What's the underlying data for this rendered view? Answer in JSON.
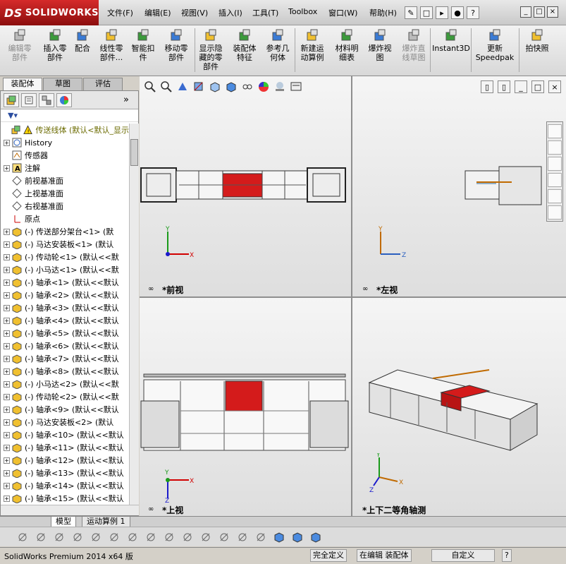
{
  "app": {
    "brand": "SOLIDWORKS",
    "brand_prefix": "DS"
  },
  "menu": [
    "文件(F)",
    "编辑(E)",
    "视图(V)",
    "插入(I)",
    "工具(T)",
    "Toolbox",
    "窗口(W)",
    "帮助(H)"
  ],
  "commands": [
    {
      "label": "编辑零\n部件",
      "disabled": true
    },
    {
      "label": "插入零\n部件",
      "disabled": false
    },
    {
      "label": "配合",
      "disabled": false
    },
    {
      "label": "线性零\n部件...",
      "disabled": false
    },
    {
      "label": "智能扣\n件",
      "disabled": false
    },
    {
      "label": "移动零\n部件",
      "disabled": false
    },
    {
      "label": "显示隐\n藏的零\n部件",
      "disabled": false
    },
    {
      "label": "装配体\n特征",
      "disabled": false
    },
    {
      "label": "参考几\n何体",
      "disabled": false
    },
    {
      "label": "新建运\n动算例",
      "disabled": false
    },
    {
      "label": "材料明\n细表",
      "disabled": false
    },
    {
      "label": "爆炸视\n图",
      "disabled": false
    },
    {
      "label": "爆炸直\n线草图",
      "disabled": true
    },
    {
      "label": "Instant3D",
      "disabled": false
    },
    {
      "label": "更新\nSpeedpak",
      "disabled": false
    },
    {
      "label": "拍快照",
      "disabled": false
    }
  ],
  "left_tabs": [
    "装配体",
    "草图",
    "评估"
  ],
  "tree": {
    "root": "传送线体  (默认<默认_显示",
    "items": [
      {
        "label": "History",
        "icon": "history-icon",
        "expand": true
      },
      {
        "label": "传感器",
        "icon": "sensor-icon",
        "expand": false
      },
      {
        "label": "注解",
        "icon": "annotation-icon",
        "expand": true
      },
      {
        "label": "前视基准面",
        "icon": "plane-icon",
        "expand": false
      },
      {
        "label": "上视基准面",
        "icon": "plane-icon",
        "expand": false
      },
      {
        "label": "右视基准面",
        "icon": "plane-icon",
        "expand": false
      },
      {
        "label": "原点",
        "icon": "origin-icon",
        "expand": false
      },
      {
        "label": "(-) 传送部分架台<1> (默",
        "icon": "part-icon",
        "expand": true
      },
      {
        "label": "(-) 马达安装板<1> (默认",
        "icon": "part-icon",
        "expand": true
      },
      {
        "label": "(-) 传动轮<1> (默认<<默",
        "icon": "part-icon",
        "expand": true
      },
      {
        "label": "(-) 小马达<1> (默认<<默",
        "icon": "part-icon",
        "expand": true
      },
      {
        "label": "(-) 轴承<1> (默认<<默认",
        "icon": "part-icon",
        "expand": true
      },
      {
        "label": "(-) 轴承<2> (默认<<默认",
        "icon": "part-icon",
        "expand": true
      },
      {
        "label": "(-) 轴承<3> (默认<<默认",
        "icon": "part-icon",
        "expand": true
      },
      {
        "label": "(-) 轴承<4> (默认<<默认",
        "icon": "part-icon",
        "expand": true
      },
      {
        "label": "(-) 轴承<5> (默认<<默认",
        "icon": "part-icon",
        "expand": true
      },
      {
        "label": "(-) 轴承<6> (默认<<默认",
        "icon": "part-icon",
        "expand": true
      },
      {
        "label": "(-) 轴承<7> (默认<<默认",
        "icon": "part-icon",
        "expand": true
      },
      {
        "label": "(-) 轴承<8> (默认<<默认",
        "icon": "part-icon",
        "expand": true
      },
      {
        "label": "(-) 小马达<2> (默认<<默",
        "icon": "part-icon",
        "expand": true
      },
      {
        "label": "(-) 传动轮<2> (默认<<默",
        "icon": "part-icon",
        "expand": true
      },
      {
        "label": "(-) 轴承<9> (默认<<默认",
        "icon": "part-icon",
        "expand": true
      },
      {
        "label": "(-) 马达安装板<2> (默认",
        "icon": "part-icon",
        "expand": true
      },
      {
        "label": "(-) 轴承<10> (默认<<默认",
        "icon": "part-icon",
        "expand": true
      },
      {
        "label": "(-) 轴承<11> (默认<<默认",
        "icon": "part-icon",
        "expand": true
      },
      {
        "label": "(-) 轴承<12> (默认<<默认",
        "icon": "part-icon",
        "expand": true
      },
      {
        "label": "(-) 轴承<13> (默认<<默认",
        "icon": "part-icon",
        "expand": true
      },
      {
        "label": "(-) 轴承<14> (默认<<默认",
        "icon": "part-icon",
        "expand": true
      },
      {
        "label": "(-) 轴承<15> (默认<<默认",
        "icon": "part-icon",
        "expand": true
      }
    ]
  },
  "views": {
    "front": "*前视",
    "left": "*左视",
    "top": "*上视",
    "iso": "*上下二等角轴测"
  },
  "bottom_tabs": [
    "模型",
    "运动算例 1"
  ],
  "status": {
    "product": "SolidWorks Premium 2014 x64 版",
    "defined": "完全定义",
    "editing": "在编辑 装配体",
    "custom": "自定义"
  },
  "colors": {
    "accent_red": "#d41b1b",
    "tree_root": "#6b6b00",
    "axis_x": "#d10000",
    "axis_y": "#1a9a1a",
    "axis_z": "#1a1acc"
  }
}
